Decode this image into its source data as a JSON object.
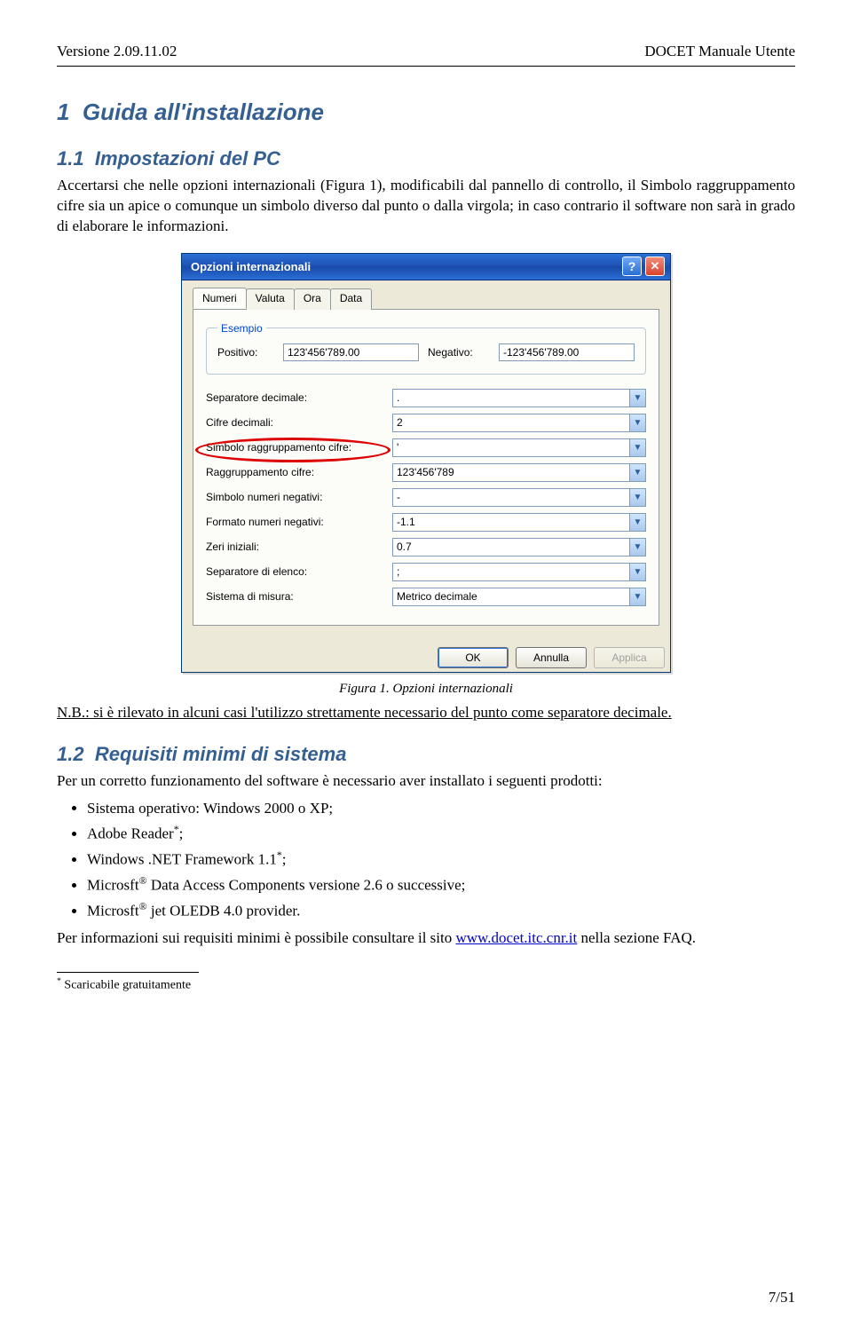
{
  "header": {
    "left": "Versione 2.09.11.02",
    "right": "DOCET Manuale Utente"
  },
  "sec1": {
    "num": "1",
    "title": "Guida all'installazione"
  },
  "sec11": {
    "num": "1.1",
    "title": "Impostazioni del PC",
    "para": "Accertarsi che nelle opzioni internazionali (Figura 1), modificabili dal pannello di controllo, il Simbolo raggruppamento cifre sia un apice o comunque un simbolo diverso dal punto o dalla virgola; in caso contrario il software non sarà in grado di elaborare le informazioni."
  },
  "dialog": {
    "title": "Opzioni internazionali",
    "tabs": [
      "Numeri",
      "Valuta",
      "Ora",
      "Data"
    ],
    "group_label": "Esempio",
    "positive_label": "Positivo:",
    "positive_value": "123'456'789.00",
    "negative_label": "Negativo:",
    "negative_value": "-123'456'789.00",
    "rows": [
      {
        "label": "Separatore decimale:",
        "value": "."
      },
      {
        "label": "Cifre decimali:",
        "value": "2"
      },
      {
        "label": "Simbolo raggruppamento cifre:",
        "value": "'"
      },
      {
        "label": "Raggruppamento cifre:",
        "value": "123'456'789"
      },
      {
        "label": "Simbolo numeri negativi:",
        "value": "-"
      },
      {
        "label": "Formato numeri negativi:",
        "value": "-1.1"
      },
      {
        "label": "Zeri iniziali:",
        "value": "0.7"
      },
      {
        "label": "Separatore di elenco:",
        "value": ";"
      },
      {
        "label": "Sistema di misura:",
        "value": "Metrico decimale"
      }
    ],
    "buttons": {
      "ok": "OK",
      "cancel": "Annulla",
      "apply": "Applica"
    }
  },
  "caption": "Figura 1. Opzioni internazionali",
  "nb_prefix": "N.B.: ",
  "nb_text": "si è rilevato in alcuni casi l'utilizzo strettamente necessario del punto come separatore decimale.",
  "sec12": {
    "num": "1.2",
    "title": "Requisiti minimi di sistema",
    "intro": "Per un corretto funzionamento del software è necessario aver installato i seguenti prodotti:",
    "b1": "Sistema operativo: Windows 2000 o XP;",
    "b2a": "Adobe Reader",
    "b2s": "*",
    "b2b": ";",
    "b3a": "Windows .NET Framework 1.1",
    "b3s": "*",
    "b3b": ";",
    "b4a": "Microsft",
    "b4sup": "®",
    "b4b": " Data Access Components versione 2.6 o successive;",
    "b5a": "Microsft",
    "b5sup": "®",
    "b5b": " jet OLEDB 4.0 provider.",
    "tail_a": "Per informazioni sui requisiti minimi è possibile consultare il sito ",
    "tail_link": "www.docet.itc.cnr.it",
    "tail_b": " nella sezione FAQ."
  },
  "footnote_mark": "*",
  "footnote_text": " Scaricabile gratuitamente",
  "page_number": "7/51"
}
